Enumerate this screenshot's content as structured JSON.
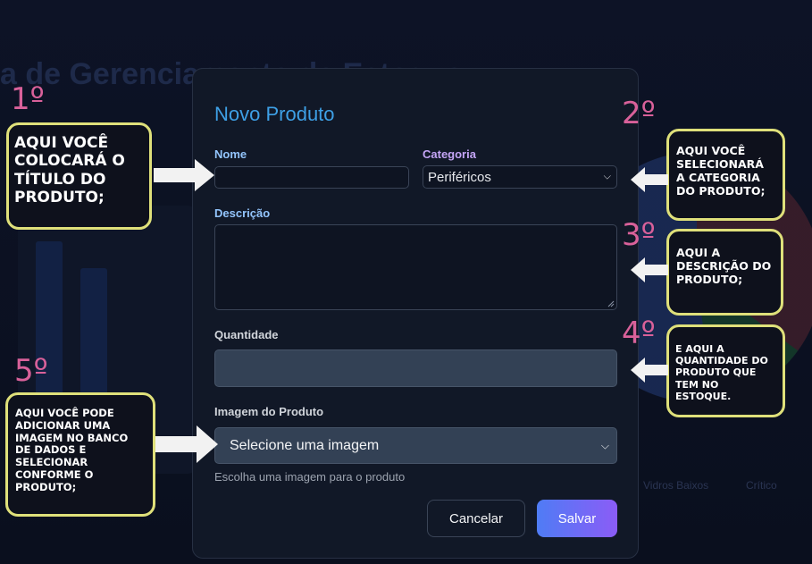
{
  "background": {
    "title_fragment": "a de Gerenciamento de Estoque",
    "legend_left": "Vidros Baixos",
    "legend_right": "Crítico"
  },
  "modal": {
    "title": "Novo Produto",
    "nome_label": "Nome",
    "nome_value": "",
    "categoria_label": "Categoria",
    "categoria_value": "Periféricos",
    "descricao_label": "Descrição",
    "descricao_value": "",
    "quantidade_label": "Quantidade",
    "quantidade_value": "",
    "imagem_label": "Imagem do Produto",
    "imagem_value": "Selecione uma imagem",
    "imagem_help": "Escolha uma imagem para o produto",
    "cancel_label": "Cancelar",
    "save_label": "Salvar"
  },
  "annotations": {
    "step1": "1º",
    "note1": "Aqui você colocará o título do produto;",
    "step2": "2º",
    "note2": "Aqui você selecionará a categoria do produto;",
    "step3": "3º",
    "note3": "Aqui a descrição do produto;",
    "step4": "4º",
    "note4": "E aqui a quantidade do produto que tem no estoque.",
    "step5": "5º",
    "note5": "Aqui você pode adicionar uma imagem no banco de dados e selecionar conforme o produto;"
  },
  "colors": {
    "accent_title": "#3ea0e6",
    "step_number": "#d9619a",
    "note_border": "#dfe07a",
    "save_gradient_start": "#4f7cf5",
    "save_gradient_end": "#8b5cf6"
  },
  "icons": [
    "chevron-down-icon",
    "arrow-right-icon",
    "arrow-left-icon"
  ]
}
